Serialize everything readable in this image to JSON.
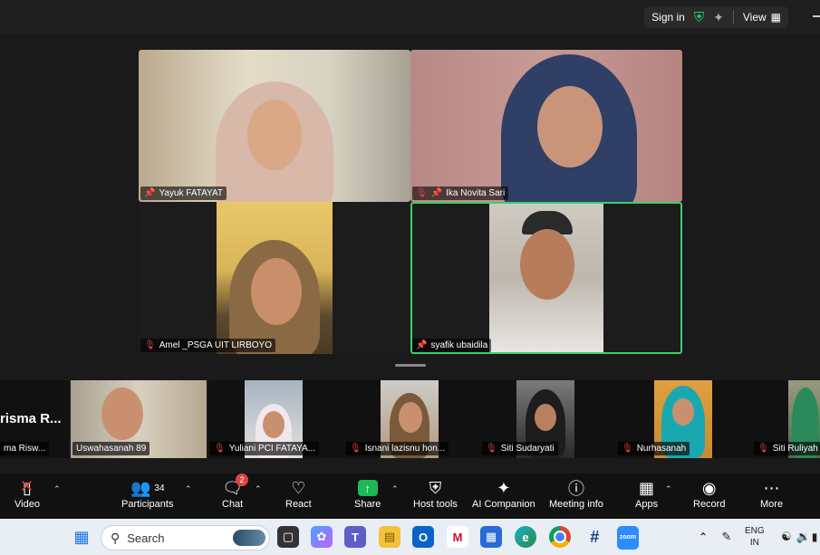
{
  "topbar": {
    "sign_in": "Sign in",
    "view": "View"
  },
  "gallery": [
    {
      "name": "Yayuk FATAYAT",
      "muted": false,
      "pinned": true
    },
    {
      "name": "Ika Novita Sari",
      "muted": true,
      "pinned": true
    },
    {
      "name": "Amel _PSGA UIT LIRBOYO",
      "muted": true,
      "pinned": false
    },
    {
      "name": "syafik ubaidila",
      "muted": false,
      "pinned": true
    }
  ],
  "strip": {
    "leading_name": "risma R...",
    "leading_label": "ma Risw...",
    "thumbs": [
      {
        "name": "Uswahasanah 89",
        "muted": false
      },
      {
        "name": "Yuliani PCI FATAYA...",
        "muted": true
      },
      {
        "name": "Isnani lazisnu hon...",
        "muted": true
      },
      {
        "name": "Siti Sudaryati",
        "muted": true
      },
      {
        "name": "Nurhasanah",
        "muted": true
      },
      {
        "name": "Siti Ruliyah",
        "muted": true
      }
    ]
  },
  "toolbar": {
    "video": "Video",
    "participants": "Participants",
    "participants_count": "34",
    "chat": "Chat",
    "chat_badge": "2",
    "react": "React",
    "share": "Share",
    "host_tools": "Host tools",
    "ai_companion": "AI Companion",
    "meeting_info": "Meeting info",
    "apps": "Apps",
    "record": "Record",
    "more": "More"
  },
  "taskbar": {
    "search_placeholder": "Search",
    "lang_top": "ENG",
    "lang_bottom": "IN",
    "zoom_label": "zoom"
  },
  "colors": {
    "active_speaker": "#3ccf6a",
    "share_green": "#1db954",
    "muted_red": "#e04343",
    "shield_green": "#2ecc71"
  }
}
